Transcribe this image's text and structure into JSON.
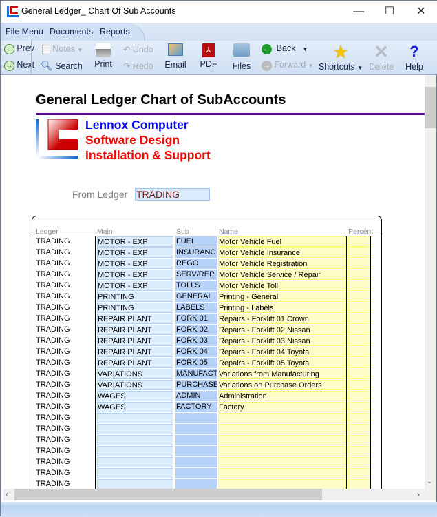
{
  "window": {
    "title": "General Ledger_ Chart Of Sub Accounts",
    "minimize": "—",
    "maximize": "☐",
    "close": "✕"
  },
  "menu": [
    "File Menu",
    "Documents",
    "Reports"
  ],
  "toolbar": {
    "prev": "Prev",
    "next": "Next",
    "notes": "Notes",
    "search": "Search",
    "print": "Print",
    "undo": "Undo",
    "redo": "Redo",
    "email": "Email",
    "pdf": "PDF",
    "files": "Files",
    "back": "Back",
    "forward": "Forward",
    "shortcuts": "Shortcuts",
    "delete": "Delete",
    "help": "Help"
  },
  "report": {
    "title": "General Ledger Chart of SubAccounts",
    "company": [
      "Lennox Computer",
      "Software Design",
      "Installation & Support"
    ],
    "from_ledger_label": "From Ledger",
    "from_ledger_value": "TRADING"
  },
  "colors": {
    "accent_line": "#5a0096",
    "company_blue": "#0000ff",
    "company_red": "#ff0000"
  },
  "table": {
    "headers": [
      "Ledger",
      "Main",
      "Sub",
      "Name",
      "Percent"
    ],
    "rows": [
      [
        "TRADING",
        "MOTOR - EXP",
        "FUEL",
        "Motor Vehicle Fuel",
        ""
      ],
      [
        "TRADING",
        "MOTOR - EXP",
        "INSURANC",
        "Motor Vehicle Insurance",
        ""
      ],
      [
        "TRADING",
        "MOTOR - EXP",
        "REGO",
        "Motor Vehicle Registration",
        ""
      ],
      [
        "TRADING",
        "MOTOR - EXP",
        "SERV/REP",
        "Motor Vehicle Service / Repair",
        ""
      ],
      [
        "TRADING",
        "MOTOR - EXP",
        "TOLLS",
        "Motor Vehicle Toll",
        ""
      ],
      [
        "TRADING",
        "PRINTING",
        "GENERAL",
        "Printing - General",
        ""
      ],
      [
        "TRADING",
        "PRINTING",
        "LABELS",
        "Printing - Labels",
        ""
      ],
      [
        "TRADING",
        "REPAIR PLANT",
        "FORK 01",
        "Repairs - Forklift 01 Crown",
        ""
      ],
      [
        "TRADING",
        "REPAIR PLANT",
        "FORK 02",
        "Repairs - Forklift 02 Nissan",
        ""
      ],
      [
        "TRADING",
        "REPAIR PLANT",
        "FORK 03",
        "Repairs - Forklift 03 Nissan",
        ""
      ],
      [
        "TRADING",
        "REPAIR PLANT",
        "FORK 04",
        "Repairs - Forklift 04 Toyota",
        ""
      ],
      [
        "TRADING",
        "REPAIR PLANT",
        "FORK 05",
        "Repairs - Forklift 05 Toyota",
        ""
      ],
      [
        "TRADING",
        "VARIATIONS",
        "MANUFACT",
        "Variations from Manufacturing",
        ""
      ],
      [
        "TRADING",
        "VARIATIONS",
        "PURCHASE",
        "Variations on Purchase Orders",
        ""
      ],
      [
        "TRADING",
        "WAGES",
        "ADMIN",
        "Administration",
        ""
      ],
      [
        "TRADING",
        "WAGES",
        "FACTORY",
        "Factory",
        ""
      ],
      [
        "TRADING",
        "",
        "",
        "",
        ""
      ],
      [
        "TRADING",
        "",
        "",
        "",
        ""
      ],
      [
        "TRADING",
        "",
        "",
        "",
        ""
      ],
      [
        "TRADING",
        "",
        "",
        "",
        ""
      ],
      [
        "TRADING",
        "",
        "",
        "",
        ""
      ],
      [
        "TRADING",
        "",
        "",
        "",
        ""
      ],
      [
        "TRADING",
        "",
        "",
        "",
        ""
      ]
    ]
  }
}
